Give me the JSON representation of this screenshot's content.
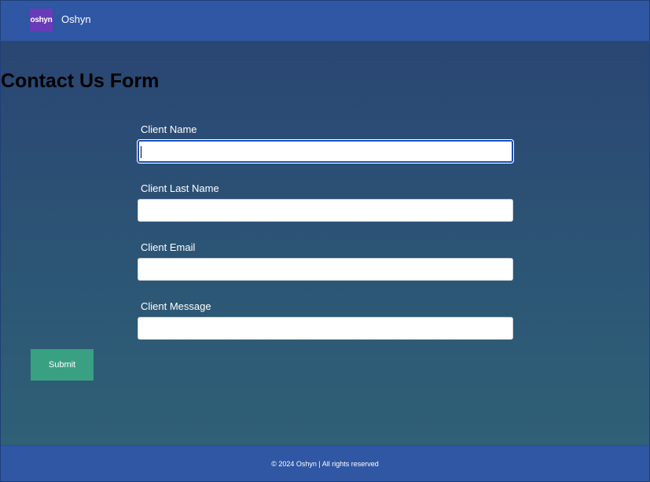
{
  "header": {
    "logo_text": "oshyn",
    "brand_name": "Oshyn",
    "logo_color": "#6a3bb8",
    "bar_color": "#2f57a4"
  },
  "form": {
    "title": "Contact Us Form",
    "fields": [
      {
        "label": "Client Name",
        "value": "",
        "focused": true
      },
      {
        "label": "Client Last Name",
        "value": ""
      },
      {
        "label": "Client Email",
        "value": ""
      },
      {
        "label": "Client Message",
        "value": ""
      }
    ],
    "submit_label": "Submit",
    "submit_color": "#3aa082"
  },
  "footer": {
    "text": "© 2024 Oshyn | All rights reserved"
  }
}
